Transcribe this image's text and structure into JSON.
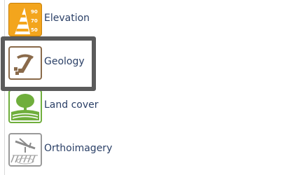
{
  "layers": [
    {
      "label": "Elevation",
      "icon": "elevation-icon",
      "scale_labels": [
        "90",
        "70",
        "50"
      ]
    },
    {
      "label": "Geology",
      "icon": "geology-hammer-icon"
    },
    {
      "label": "Land cover",
      "icon": "land-cover-tree-icon"
    },
    {
      "label": "Orthoimagery",
      "icon": "orthoimagery-plane-icon"
    }
  ],
  "selected_layer": "Geology",
  "colors": {
    "elevation": "#f3a51d",
    "geology": "#8a6a4a",
    "land_cover": "#6fae3c",
    "orthoimagery": "#9a9a9a",
    "label_text": "#2a3f66",
    "selection_frame": "#5b5b5b"
  }
}
